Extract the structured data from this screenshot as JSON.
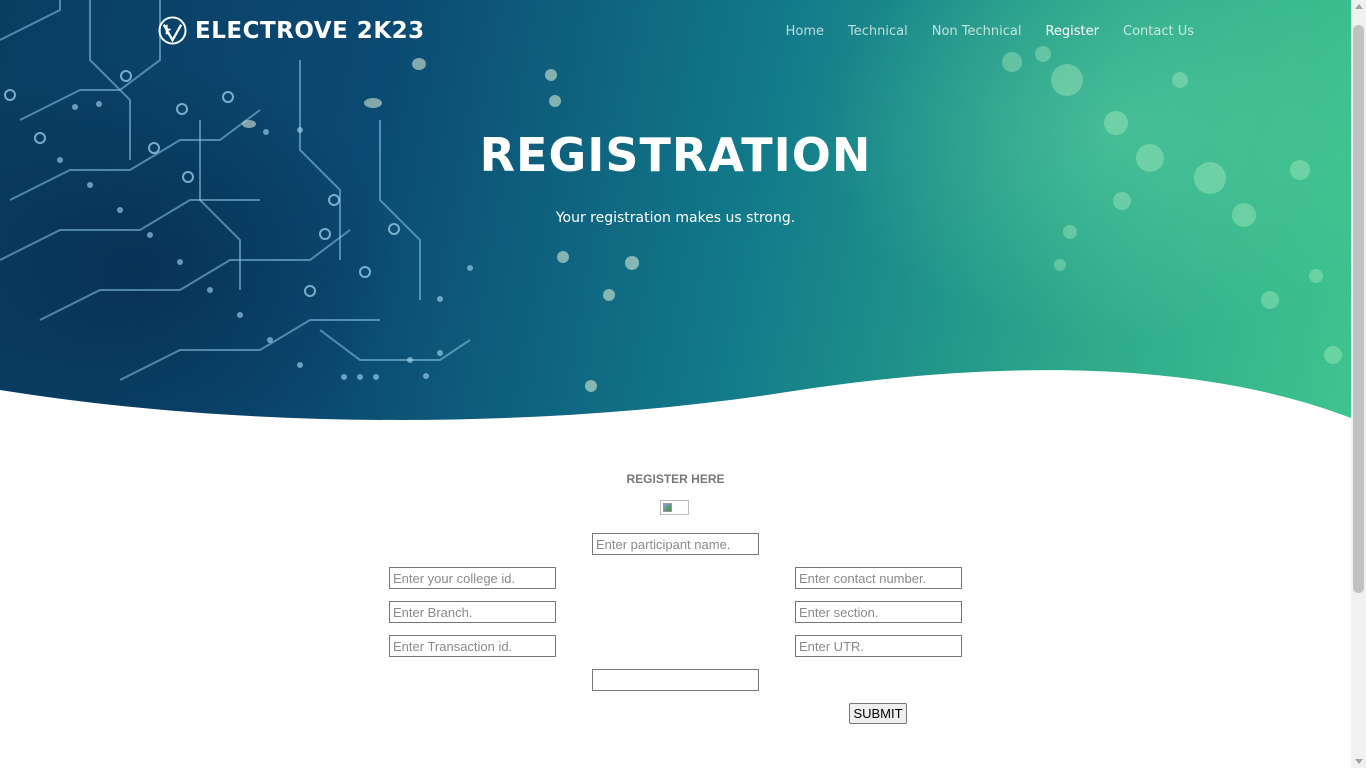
{
  "brand": {
    "name": "ELECTROVE 2K23",
    "logo_icon": "ev-shield-logo-icon"
  },
  "nav": {
    "items": [
      "Home",
      "Technical",
      "Non Technical",
      "Register",
      "Contact Us"
    ],
    "active": "Register"
  },
  "hero": {
    "title": "REGISTRATION",
    "subtitle": "Your registration makes us strong."
  },
  "form": {
    "heading": "REGISTER HERE",
    "fields": {
      "participant_name": {
        "placeholder": "Enter participant name.",
        "value": ""
      },
      "college_id": {
        "placeholder": "Enter your college id.",
        "value": ""
      },
      "contact_number": {
        "placeholder": "Enter contact number.",
        "value": ""
      },
      "branch": {
        "placeholder": "Enter Branch.",
        "value": ""
      },
      "section": {
        "placeholder": "Enter section.",
        "value": ""
      },
      "transaction_id": {
        "placeholder": "Enter Transaction id.",
        "value": ""
      },
      "utr": {
        "placeholder": "Enter UTR.",
        "value": ""
      },
      "extra": {
        "placeholder": "",
        "value": ""
      }
    },
    "submit_label": "SUBMIT"
  },
  "colors": {
    "hero_gradient_start": "#0a3d62",
    "hero_gradient_end": "#3fc48f",
    "nav_text": "#ffffffb8",
    "nav_active": "#ffffff",
    "heading_gray": "#777777"
  }
}
